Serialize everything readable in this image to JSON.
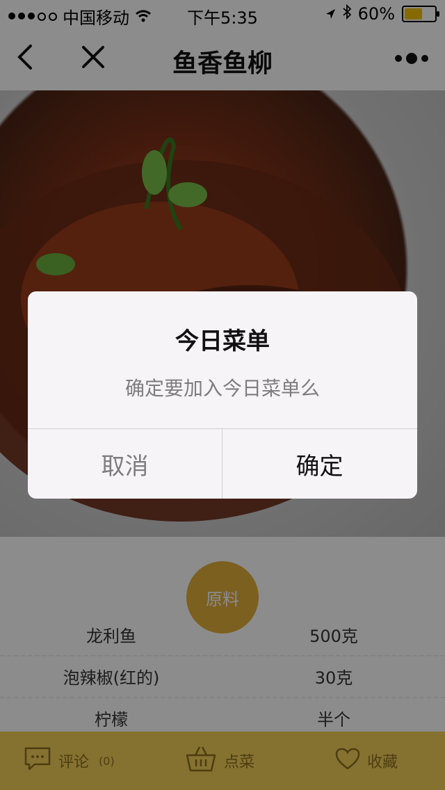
{
  "status_bar": {
    "carrier": "中国移动",
    "time": "下午5:35",
    "battery_text": "60%",
    "battery_level": 0.6
  },
  "nav_bar": {
    "title": "鱼香鱼柳",
    "back_icon": "chevron-left-icon",
    "close_icon": "close-icon",
    "more_icon": "more-dots-icon"
  },
  "ingredients": {
    "badge": "原料",
    "rows": [
      {
        "name": "龙利鱼",
        "qty": "500克"
      },
      {
        "name": "泡辣椒(红的)",
        "qty": "30克"
      },
      {
        "name": "柠檬",
        "qty": "半个"
      }
    ]
  },
  "tab_bar": {
    "comment_label": "评论",
    "comment_count": "(0)",
    "order_label": "点菜",
    "favorite_label": "收藏"
  },
  "dialog": {
    "title": "今日菜单",
    "message": "确定要加入今日菜单么",
    "cancel_label": "取消",
    "confirm_label": "确定"
  },
  "colors": {
    "accent": "#e2b03a",
    "tabbar": "#f2cf59"
  }
}
